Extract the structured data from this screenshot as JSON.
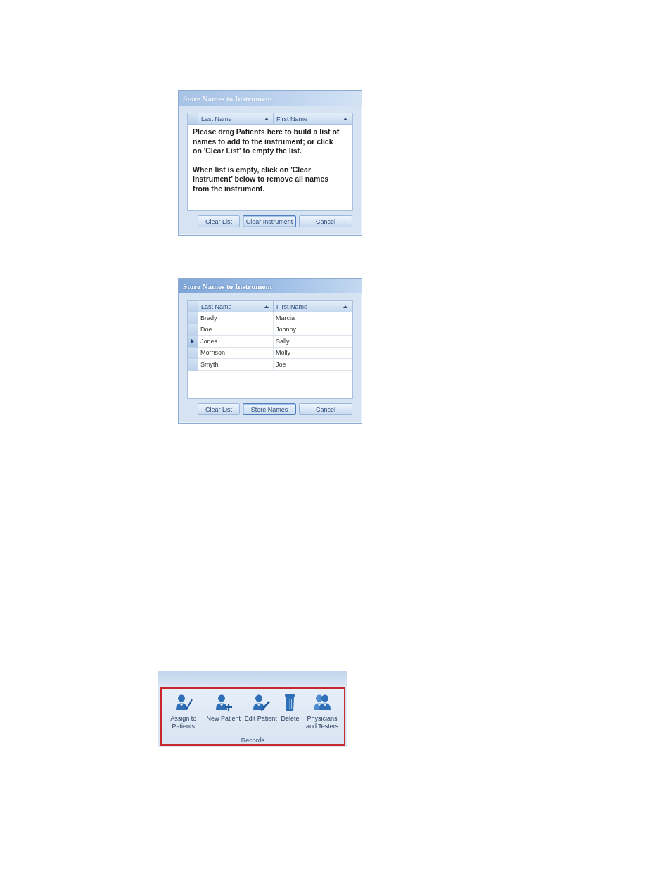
{
  "dialogs": [
    {
      "title": "Store Names to Instrument",
      "active": false,
      "columns": [
        {
          "label": "Last Name",
          "sorted": true
        },
        {
          "label": "First Name",
          "sorted": true
        }
      ],
      "message": [
        "Please drag Patients here to build a list of names to add to the instrument; or click on 'Clear List' to empty the list.",
        "When list is empty, click on 'Clear Instrument’ below to remove all names from the instrument."
      ],
      "buttons": [
        {
          "label": "Clear List",
          "focused": false
        },
        {
          "label": "Clear Instrument",
          "focused": true
        },
        {
          "label": "Cancel",
          "focused": false
        }
      ]
    },
    {
      "title": "Store Names to Instrument",
      "active": true,
      "columns": [
        {
          "label": "Last Name",
          "sorted": true
        },
        {
          "label": "First Name",
          "sorted": true
        }
      ],
      "rows": [
        {
          "cells": [
            "Brady",
            "Marcia"
          ],
          "selected": false
        },
        {
          "cells": [
            "Doe",
            "Johnny"
          ],
          "selected": false
        },
        {
          "cells": [
            "Jones",
            "Sally"
          ],
          "selected": true
        },
        {
          "cells": [
            "Morrison",
            "Molly"
          ],
          "selected": false
        },
        {
          "cells": [
            "Smyth",
            "Joe"
          ],
          "selected": false
        }
      ],
      "buttons": [
        {
          "label": "Clear List",
          "focused": false
        },
        {
          "label": "Store Names",
          "focused": true
        },
        {
          "label": "Cancel",
          "focused": false
        }
      ]
    }
  ],
  "ribbon": {
    "group": {
      "label": "Records",
      "highlighted": true,
      "buttons": [
        {
          "label": "Assign to Patients",
          "kind": "assign"
        },
        {
          "label": "New Patient",
          "kind": "add"
        },
        {
          "label": "Edit Patient",
          "kind": "edit"
        },
        {
          "label": "Delete",
          "kind": "delete"
        },
        {
          "label": "Physicians and Testers",
          "kind": "group"
        }
      ]
    }
  }
}
